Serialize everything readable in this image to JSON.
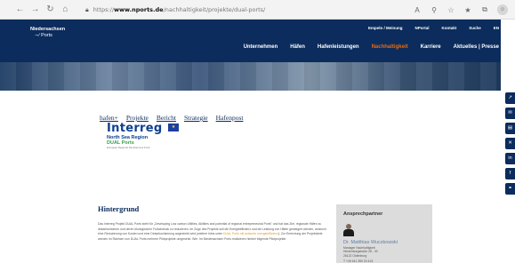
{
  "browser": {
    "url_prefix": "https://",
    "url_domain": "www.nports.de",
    "url_path": "/nachhaltigkeit/projekte/dual-ports/",
    "icons": [
      "back-icon",
      "forward-icon",
      "reload-icon",
      "home-icon"
    ],
    "tool_icons": [
      "read-aloud-icon",
      "zoom-icon",
      "favorite-icon",
      "favorites-bar-icon",
      "collections-icon",
      "profile-icon"
    ]
  },
  "site": {
    "logo_line1": "Niedersachsen",
    "logo_line2": "Ports",
    "top_links": [
      "Empelo / Meinung",
      "NPortal",
      "Kontakt",
      "Suche",
      "EN"
    ],
    "main_nav": [
      "Unternehmen",
      "Häfen",
      "Hafenleistungen",
      "Nachhaltigkeit",
      "Karriere",
      "Aktuelles | Presse"
    ],
    "active_nav": "Nachhaltigkeit",
    "accent_color": "#e86a10",
    "brand_color": "#0b2c5c"
  },
  "subnav": [
    "hafen+",
    "Projekte",
    "Bericht",
    "Strategie",
    "Hafenpost"
  ],
  "interreg": {
    "word": "Interreg",
    "region": "North Sea Region",
    "project": "DUAL Ports",
    "tagline": "European Regional Development Fund"
  },
  "content": {
    "heading": "Hintergrund",
    "paragraph_start": "Das Interreg Projekt DUAL Ports steht für „Developing Low carbon Utilities, Abilities and potential of regional entrepreneurial Ports\" und hat das Ziel, regionale Häfen zu dekarbonisieren und deren ökologischen Fußabdruck zu reduzieren. Im Zuge des Projekts soll die Energieeffizienz und die Leistung von Häfen gesteigert werden, wodurch eine Reduzierung von Kosten und eine Dekarbonisierung angestrebt wird (weitere Infos unter ",
    "paragraph_link": "DUAL Ports mit antworte energieeffizienz",
    "paragraph_end": "). Zur Erreichung der Projektziele werden im Rahmen von DUAL Ports mehrere Pilotprojekte umgesetzt. Wie: Im Niedersachsen Ports realisieren hierbei folgende Pilotprojekte"
  },
  "contact": {
    "title": "Ansprechpartner",
    "name": "Dr. Matthias Wuczkowski",
    "role": "Manager Nachhaltigkeit",
    "street": "Hindenburgstraße 28 - 30",
    "city": "26122 Oldenburg",
    "phone": "T +49 441 350 20 413"
  },
  "rail": [
    "share-icon",
    "mail-icon",
    "print-icon",
    "xing-icon",
    "linkedin-icon",
    "facebook-icon",
    "copy-link-icon"
  ]
}
